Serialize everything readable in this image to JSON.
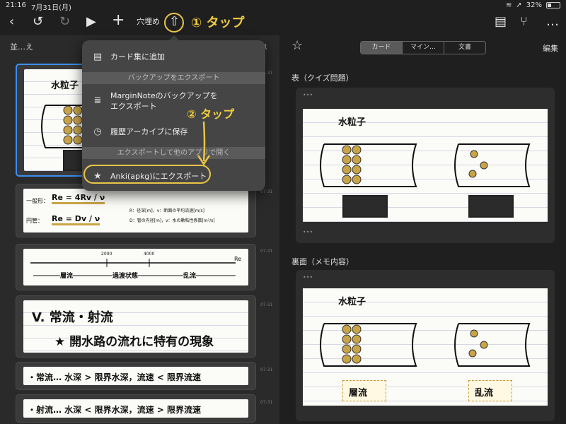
{
  "status": {
    "time": "21:16",
    "date": "7月31日(月)",
    "battery": "32%",
    "battery_level": 0.32
  },
  "toolbar": {
    "back": "‹",
    "undo": "↺",
    "redo": "↻",
    "play": "▶",
    "add": "+",
    "cloze_label": "穴埋め",
    "share": "⇧",
    "doc": "▤",
    "mindmap": "⑂",
    "more": "…"
  },
  "annotations": {
    "tap1": "① タップ",
    "tap2": "② タップ"
  },
  "left": {
    "title": "並…え",
    "r_label": "R",
    "card_date": "07-31"
  },
  "notes": {
    "n1_label": "水粒子",
    "n2": {
      "line1_prefix": "一般形：",
      "line1_formula": "Re = 4Rv / ν",
      "line2_prefix": "円管：",
      "line2_formula": "Re = Dv / ν",
      "legend1": "R：径深[m]，v：断面の平均流速[m/s]",
      "legend2": "D：管の内径[m]，ν：水の動粘性係数[m²/s]"
    },
    "n3": {
      "t2000": "2000",
      "t4000": "4000",
      "re": "Re",
      "laminar": "層流",
      "transition": "過渡状態",
      "turbulent": "乱流"
    },
    "n4": {
      "line1": "V. 常流・射流",
      "line2": "★ 開水路の流れに特有の現象"
    },
    "n5": "・常流… 水深 > 限界水深，流速 < 限界流速",
    "n6": "・射流… 水深 < 限界水深，流速 > 限界流速"
  },
  "right": {
    "star": "☆",
    "tabs": [
      "カード",
      "マイン…",
      "文書"
    ],
    "edit": "編集",
    "front_title": "表（クイズ問題）",
    "back_title": "裏面（メモ内容）",
    "dots": "•••",
    "label_water": "水粒子",
    "laminar": "層流",
    "turbulent": "乱流"
  },
  "popover": {
    "add_to_deck": "カード集に追加",
    "backup_section": "バックアップをエクスポート",
    "marginnote_backup_l1": "MarginNoteのバックアップを",
    "marginnote_backup_l2": "エクスポート",
    "history_archive": "履歴アーカイブに保存",
    "export_section": "エクスポートして他のアプリで開く",
    "anki_export": "Anki(apkg)にエクスポート"
  },
  "colors": {
    "accent": "#e8c547",
    "selection": "#3d8ef0",
    "gold": "#c9962c"
  }
}
